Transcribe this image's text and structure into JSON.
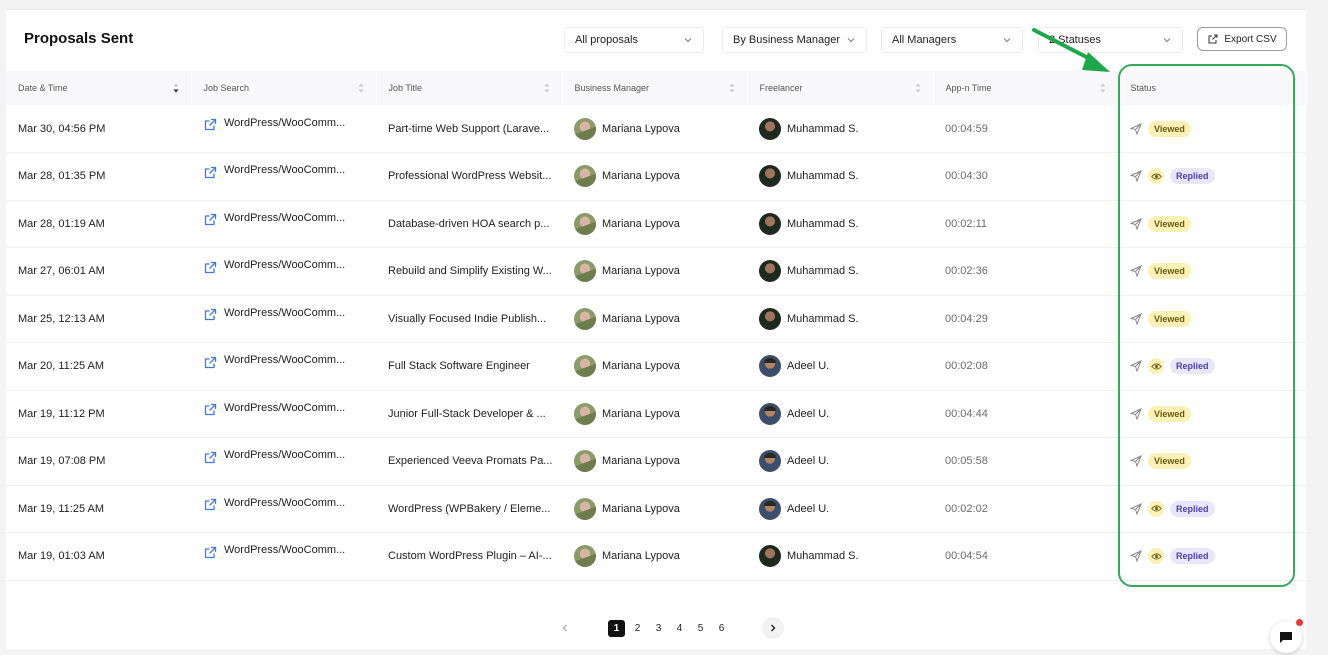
{
  "header": {
    "title": "Proposals Sent",
    "filters": [
      {
        "value": "All proposals"
      },
      {
        "value": "By Business Manager"
      },
      {
        "value": "All Managers"
      },
      {
        "value": "2 Statuses"
      }
    ],
    "export_label": "Export CSV"
  },
  "table": {
    "columns": [
      "Date & Time",
      "Job Search",
      "Job Title",
      "Business Manager",
      "Freelancer",
      "App-n Time",
      "Status"
    ],
    "rows": [
      {
        "date": "Mar 30, 04:56 PM",
        "search": "WordPress/WooComm...",
        "title": "Part-time Web Support (Larave...",
        "manager": "Mariana Lypova",
        "freelancer": "Muhammad S.",
        "time": "00:04:59",
        "status": "Viewed"
      },
      {
        "date": "Mar 28, 01:35 PM",
        "search": "WordPress/WooComm...",
        "title": "Professional WordPress Websit...",
        "manager": "Mariana Lypova",
        "freelancer": "Muhammad S.",
        "time": "00:04:30",
        "status": "Replied"
      },
      {
        "date": "Mar 28, 01:19 AM",
        "search": "WordPress/WooComm...",
        "title": "Database-driven HOA search p...",
        "manager": "Mariana Lypova",
        "freelancer": "Muhammad S.",
        "time": "00:02:11",
        "status": "Viewed"
      },
      {
        "date": "Mar 27, 06:01 AM",
        "search": "WordPress/WooComm...",
        "title": "Rebuild and Simplify Existing W...",
        "manager": "Mariana Lypova",
        "freelancer": "Muhammad S.",
        "time": "00:02:36",
        "status": "Viewed"
      },
      {
        "date": "Mar 25, 12:13 AM",
        "search": "WordPress/WooComm...",
        "title": "Visually Focused Indie Publish...",
        "manager": "Mariana Lypova",
        "freelancer": "Muhammad S.",
        "time": "00:04:29",
        "status": "Viewed"
      },
      {
        "date": "Mar 20, 11:25 AM",
        "search": "WordPress/WooComm...",
        "title": "Full Stack Software Engineer",
        "manager": "Mariana Lypova",
        "freelancer": "Adeel U.",
        "time": "00:02:08",
        "status": "Replied"
      },
      {
        "date": "Mar 19, 11:12 PM",
        "search": "WordPress/WooComm...",
        "title": "Junior Full-Stack Developer & ...",
        "manager": "Mariana Lypova",
        "freelancer": "Adeel U.",
        "time": "00:04:44",
        "status": "Viewed"
      },
      {
        "date": "Mar 19, 07:08 PM",
        "search": "WordPress/WooComm...",
        "title": "Experienced Veeva Promats Pa...",
        "manager": "Mariana Lypova",
        "freelancer": "Adeel U.",
        "time": "00:05:58",
        "status": "Viewed"
      },
      {
        "date": "Mar 19, 11:25 AM",
        "search": "WordPress/WooComm...",
        "title": "WordPress (WPBakery / Eleme...",
        "manager": "Mariana Lypova",
        "freelancer": "Adeel U.",
        "time": "00:02:02",
        "status": "Replied"
      },
      {
        "date": "Mar 19, 01:03 AM",
        "search": "WordPress/WooComm...",
        "title": "Custom WordPress Plugin – AI-...",
        "manager": "Mariana Lypova",
        "freelancer": "Muhammad S.",
        "time": "00:04:54",
        "status": "Replied"
      }
    ]
  },
  "pagination": {
    "pages": [
      "1",
      "2",
      "3",
      "4",
      "5",
      "6"
    ],
    "current": "1"
  },
  "colors": {
    "highlight": "#39a75c",
    "viewed_badge": "#fbf1b7",
    "replied_badge": "#e9e6fb"
  },
  "icons": {
    "job_search": "external-link-icon",
    "status_sent": "paper-plane-icon",
    "status_seen": "eye-icon",
    "export": "export-icon",
    "chat": "chat-icon"
  }
}
